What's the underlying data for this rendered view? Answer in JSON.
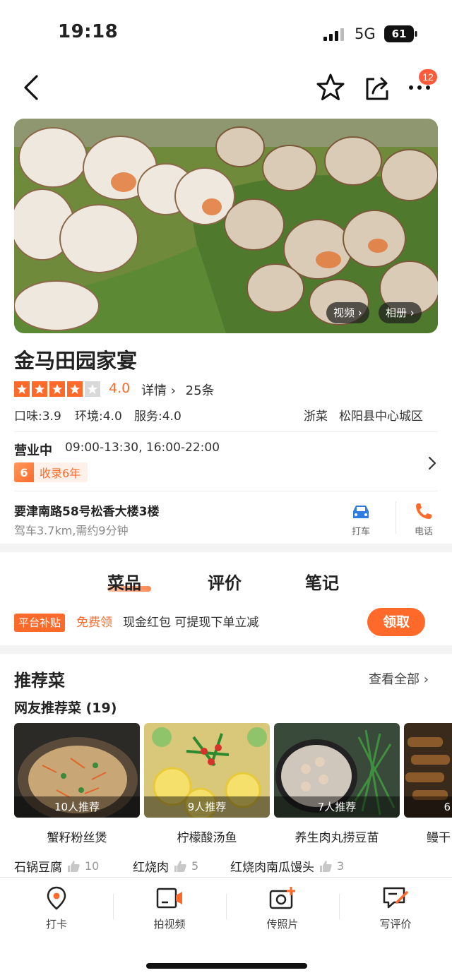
{
  "status": {
    "time": "19:18",
    "network": "5G",
    "battery": "61"
  },
  "header": {
    "badge": "12"
  },
  "hero": {
    "video_label": "视频 ›",
    "album_label": "相册 ›"
  },
  "shop": {
    "name": "金马田园家宴",
    "rating": 4.0,
    "rating_text": "4.0",
    "detail_label": "详情 ›",
    "review_count": "25条",
    "taste": "口味:3.9",
    "env": "环境:4.0",
    "service": "服务:4.0",
    "cuisine": "浙菜",
    "area": "松阳县中心城区",
    "status": "营业中",
    "hours": "09:00-13:30, 16:00-22:00",
    "years_num": "6",
    "years_label": "收录6年",
    "address": "要津南路58号松香大楼3楼",
    "distance": "驾车3.7km,需约9分钟",
    "taxi_label": "打车",
    "phone_label": "电话"
  },
  "tabs": [
    {
      "label": "菜品"
    },
    {
      "label": "评价"
    },
    {
      "label": "笔记"
    }
  ],
  "promo": {
    "tag": "平台补贴",
    "free": "免费领",
    "text": "现金红包 可提现下单立减",
    "button": "领取"
  },
  "recommend": {
    "title": "推荐菜",
    "see_all": "查看全部 ›",
    "subtitle": "网友推荐菜 (19)",
    "dishes": [
      {
        "name": "蟹籽粉丝煲",
        "count": "10人推荐"
      },
      {
        "name": "柠檬酸汤鱼",
        "count": "9人推荐"
      },
      {
        "name": "养生肉丸捞豆苗",
        "count": "7人推荐"
      },
      {
        "name": "鳗干",
        "count": "6"
      }
    ],
    "tags": [
      {
        "name": "石锅豆腐",
        "count": "10"
      },
      {
        "name": "红烧肉",
        "count": "5"
      },
      {
        "name": "红烧肉南瓜馒头",
        "count": "3"
      }
    ]
  },
  "bottom_nav": [
    {
      "label": "打卡"
    },
    {
      "label": "拍视频"
    },
    {
      "label": "传照片"
    },
    {
      "label": "写评价"
    }
  ],
  "colors": {
    "accent": "#ff6a2b",
    "taxi": "#2f7de1",
    "phone": "#ff6a2b"
  }
}
